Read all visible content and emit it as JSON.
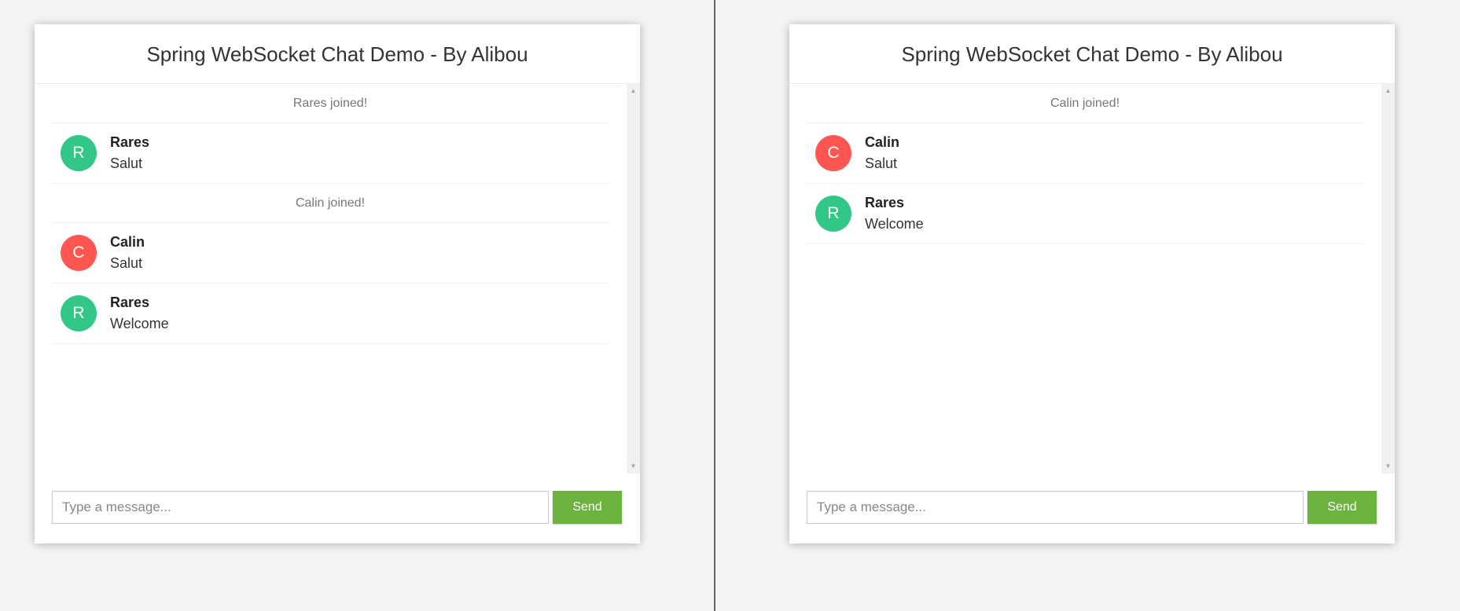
{
  "left": {
    "title": "Spring WebSocket Chat Demo - By Alibou",
    "messages": [
      {
        "type": "event",
        "text": "Rares joined!"
      },
      {
        "type": "chat",
        "sender": "Rares",
        "initial": "R",
        "color": "#32c787",
        "text": "Salut"
      },
      {
        "type": "event",
        "text": "Calin joined!"
      },
      {
        "type": "chat",
        "sender": "Calin",
        "initial": "C",
        "color": "#ff5652",
        "text": "Salut"
      },
      {
        "type": "chat",
        "sender": "Rares",
        "initial": "R",
        "color": "#32c787",
        "text": "Welcome"
      }
    ],
    "input_placeholder": "Type a message...",
    "send_label": "Send"
  },
  "right": {
    "title": "Spring WebSocket Chat Demo - By Alibou",
    "messages": [
      {
        "type": "event",
        "text": "Calin joined!"
      },
      {
        "type": "chat",
        "sender": "Calin",
        "initial": "C",
        "color": "#ff5652",
        "text": "Salut"
      },
      {
        "type": "chat",
        "sender": "Rares",
        "initial": "R",
        "color": "#32c787",
        "text": "Welcome"
      }
    ],
    "input_placeholder": "Type a message...",
    "send_label": "Send"
  },
  "theme": {
    "accent": "#6db33f",
    "avatar_green": "#32c787",
    "avatar_red": "#ff5652"
  }
}
